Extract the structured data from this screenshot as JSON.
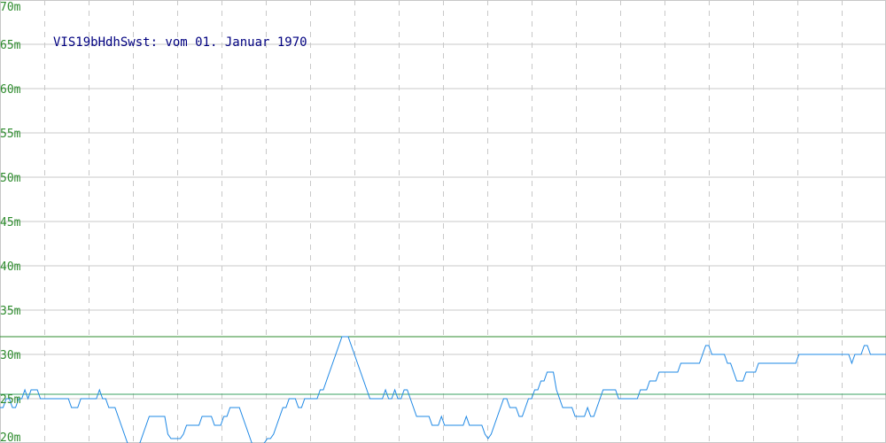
{
  "chart_data": {
    "type": "line",
    "title": "VIS19bHdhSwst: vom 01. Januar 1970",
    "xlabel": "",
    "ylabel": "",
    "ylim": [
      20,
      70
    ],
    "yticks": [
      {
        "value": 20,
        "label": "20m"
      },
      {
        "value": 25,
        "label": "25m"
      },
      {
        "value": 30,
        "label": "30m"
      },
      {
        "value": 35,
        "label": "35m"
      },
      {
        "value": 40,
        "label": "40m"
      },
      {
        "value": 45,
        "label": "45m"
      },
      {
        "value": 50,
        "label": "50m"
      },
      {
        "value": 55,
        "label": "55m"
      },
      {
        "value": 60,
        "label": "60m"
      },
      {
        "value": 65,
        "label": "65m"
      },
      {
        "value": 70,
        "label": "70m"
      }
    ],
    "x_gridlines": 20,
    "grid": true,
    "reference_lines": [
      {
        "value": 32,
        "color": "#2e8b2e"
      },
      {
        "value": 25.5,
        "color": "#3aa060"
      }
    ],
    "series_color": "#1e88e5",
    "series": [
      {
        "values": [
          24,
          24,
          25,
          25,
          24,
          24,
          25,
          25,
          26,
          25,
          26,
          26,
          26,
          25,
          25,
          25,
          25,
          25,
          25,
          25,
          25,
          25,
          25,
          24,
          24,
          24,
          25,
          25,
          25,
          25,
          25,
          25,
          26,
          25,
          25,
          24,
          24,
          24,
          23,
          22,
          21,
          20,
          19.5,
          19.5,
          19.5,
          20,
          21,
          22,
          23,
          23,
          23,
          23,
          23,
          23,
          21,
          20.5,
          20.5,
          20.5,
          20.5,
          21,
          22,
          22,
          22,
          22,
          22,
          23,
          23,
          23,
          23,
          22,
          22,
          22,
          23,
          23,
          24,
          24,
          24,
          24,
          23,
          22,
          21,
          20,
          19.5,
          19.5,
          19.5,
          20,
          20.5,
          20.5,
          21,
          22,
          23,
          24,
          24,
          25,
          25,
          25,
          24,
          24,
          25,
          25,
          25,
          25,
          25,
          26,
          26,
          27,
          28,
          29,
          30,
          31,
          32,
          32,
          32,
          31,
          30,
          29,
          28,
          27,
          26,
          25,
          25,
          25,
          25,
          25,
          26,
          25,
          25,
          26,
          25,
          25,
          26,
          26,
          25,
          24,
          23,
          23,
          23,
          23,
          23,
          22,
          22,
          22,
          23,
          22,
          22,
          22,
          22,
          22,
          22,
          22,
          23,
          22,
          22,
          22,
          22,
          22,
          21,
          20.5,
          21,
          22,
          23,
          24,
          25,
          25,
          24,
          24,
          24,
          23,
          23,
          24,
          25,
          25,
          26,
          26,
          27,
          27,
          28,
          28,
          28,
          26,
          25,
          24,
          24,
          24,
          24,
          23,
          23,
          23,
          23,
          24,
          23,
          23,
          24,
          25,
          26,
          26,
          26,
          26,
          26,
          25,
          25,
          25,
          25,
          25,
          25,
          25,
          26,
          26,
          26,
          27,
          27,
          27,
          28,
          28,
          28,
          28,
          28,
          28,
          28,
          29,
          29,
          29,
          29,
          29,
          29,
          29,
          30,
          31,
          31,
          30,
          30,
          30,
          30,
          30,
          29,
          29,
          28,
          27,
          27,
          27,
          28,
          28,
          28,
          28,
          29,
          29,
          29,
          29,
          29,
          29,
          29,
          29,
          29,
          29,
          29,
          29,
          29,
          30,
          30,
          30,
          30,
          30,
          30,
          30,
          30,
          30,
          30,
          30,
          30,
          30,
          30,
          30,
          30,
          30,
          29,
          30,
          30,
          30,
          31,
          31,
          30,
          30,
          30,
          30,
          30,
          30
        ]
      }
    ]
  }
}
